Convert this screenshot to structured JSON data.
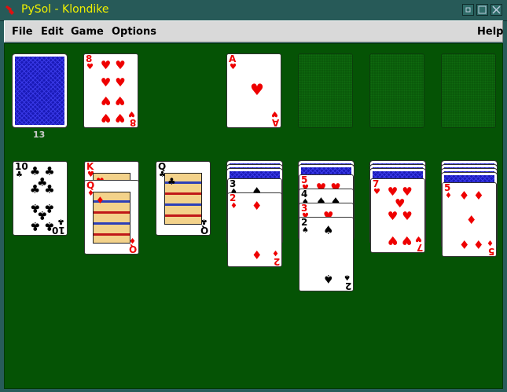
{
  "window": {
    "title": "PySol - Klondike",
    "app_icon": "pysol-icon",
    "controls": [
      "iconify-icon",
      "maximize-icon",
      "close-icon"
    ],
    "title_color": "#f0f000"
  },
  "menubar": {
    "file": "File",
    "edit": "Edit",
    "game": "Game",
    "options": "Options",
    "help": "Help"
  },
  "table": {
    "background": "#055305",
    "stock": {
      "count": "13"
    },
    "waste": {
      "rank": "8",
      "suit": "hearts"
    },
    "foundations": [
      {
        "rank": "A",
        "suit": "hearts"
      },
      {
        "empty": true
      },
      {
        "empty": true
      },
      {
        "empty": true
      }
    ],
    "tableau": [
      {
        "hidden": 0,
        "face_up": [
          {
            "rank": "10",
            "suit": "clubs"
          }
        ]
      },
      {
        "hidden": 0,
        "face_up": [
          {
            "rank": "K",
            "suit": "hearts"
          },
          {
            "rank": "Q",
            "suit": "diamonds"
          }
        ]
      },
      {
        "hidden": 0,
        "face_up": [
          {
            "rank": "Q",
            "suit": "clubs"
          }
        ]
      },
      {
        "hidden": 3,
        "face_up": [
          {
            "rank": "3",
            "suit": "spades"
          },
          {
            "rank": "2",
            "suit": "diamonds"
          }
        ]
      },
      {
        "hidden": 2,
        "face_up": [
          {
            "rank": "5",
            "suit": "hearts"
          },
          {
            "rank": "4",
            "suit": "spades"
          },
          {
            "rank": "3",
            "suit": "hearts"
          },
          {
            "rank": "2",
            "suit": "spades"
          }
        ]
      },
      {
        "hidden": 3,
        "face_up": [
          {
            "rank": "7",
            "suit": "hearts"
          }
        ]
      },
      {
        "hidden": 4,
        "face_up": [
          {
            "rank": "5",
            "suit": "diamonds"
          }
        ]
      }
    ]
  }
}
